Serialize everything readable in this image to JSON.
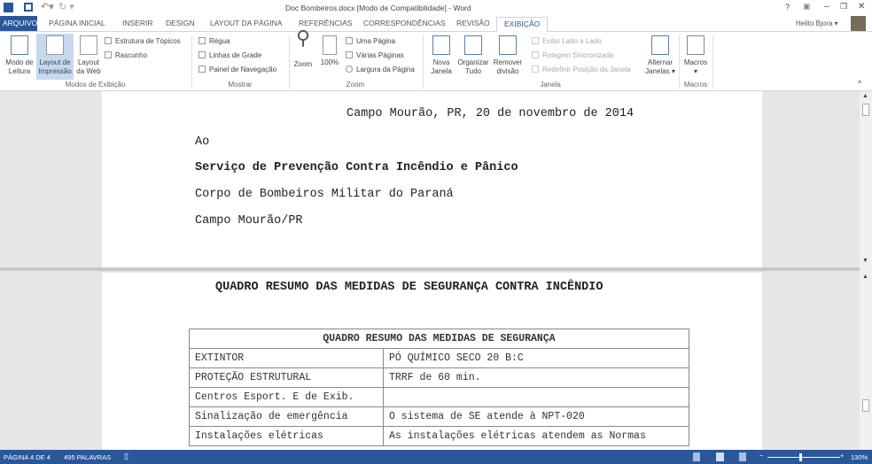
{
  "titlebar": {
    "title": "Doc Bombeiros.docx [Modo de Compatibilidade] - Word",
    "help": "?",
    "minimize": "–",
    "restore": "❐",
    "close": "✕"
  },
  "tabs": [
    "ARQUIVO",
    "PÁGINA INICIAL",
    "INSERIR",
    "DESIGN",
    "LAYOUT DA PÁGINA",
    "REFERÊNCIAS",
    "CORRESPONDÊNCIAS",
    "REVISÃO",
    "EXIBIÇÃO"
  ],
  "user": "Helito Bjora ▾",
  "ribbon": {
    "modos": {
      "label": "Modos de Exibição",
      "leitura": [
        "Modo de",
        "Leitura"
      ],
      "impressao": [
        "Layout de",
        "Impressão"
      ],
      "web": [
        "Layout",
        "da Web"
      ],
      "estrutura": "Estrutura de Tópicos",
      "rascunho": "Rascunho"
    },
    "mostrar": {
      "label": "Mostrar",
      "regua": "Régua",
      "linhas": "Linhas de Grade",
      "painel": "Painel de Navegação"
    },
    "zoom": {
      "label": "Zoom",
      "zoom": "Zoom",
      "cem": "100%",
      "uma": "Uma Página",
      "varias": "Várias Páginas",
      "largura": "Largura da Página"
    },
    "janela": {
      "label": "Janela",
      "nova": [
        "Nova",
        "Janela"
      ],
      "organizar": [
        "Organizar",
        "Tudo"
      ],
      "remover": [
        "Remover",
        "divisão"
      ],
      "lado": "Exibir Lado a Lado",
      "rolagem": "Rolagem Sincronizada",
      "redefinir": "Redefinir Posição da Janela",
      "alternar": [
        "Alternar",
        "Janelas ▾"
      ]
    },
    "macros": {
      "label": "Macros",
      "macros": "Macros",
      "arrow": "▾"
    }
  },
  "doc": {
    "date": "Campo Mourão, PR, 20 de novembro de 2014",
    "ao": "Ao",
    "org": "Serviço de Prevenção Contra Incêndio e Pânico",
    "corpo": "Corpo de Bombeiros Militar do Paraná",
    "city": "Campo Mourão/PR",
    "heading": "QUADRO RESUMO DAS MEDIDAS DE SEGURANÇA CONTRA INCÊNDIO",
    "table_title": "QUADRO RESUMO DAS MEDIDAS DE SEGURANÇA",
    "rows": [
      [
        "EXTINTOR",
        "PÓ QUÍMICO SECO 20 B:C"
      ],
      [
        "PROTEÇÃO ESTRUTURAL",
        "TRRF de 60 min."
      ],
      [
        "Centros Esport. E de Exib.",
        ""
      ],
      [
        "Sinalização de emergência",
        "O sistema de SE atende à NPT-020"
      ],
      [
        "Instalações elétricas",
        "As instalações elétricas atendem as Normas"
      ]
    ]
  },
  "status": {
    "page": "PÁGINA 4 DE 4",
    "words": "495 PALAVRAS",
    "zoom": "130%"
  }
}
